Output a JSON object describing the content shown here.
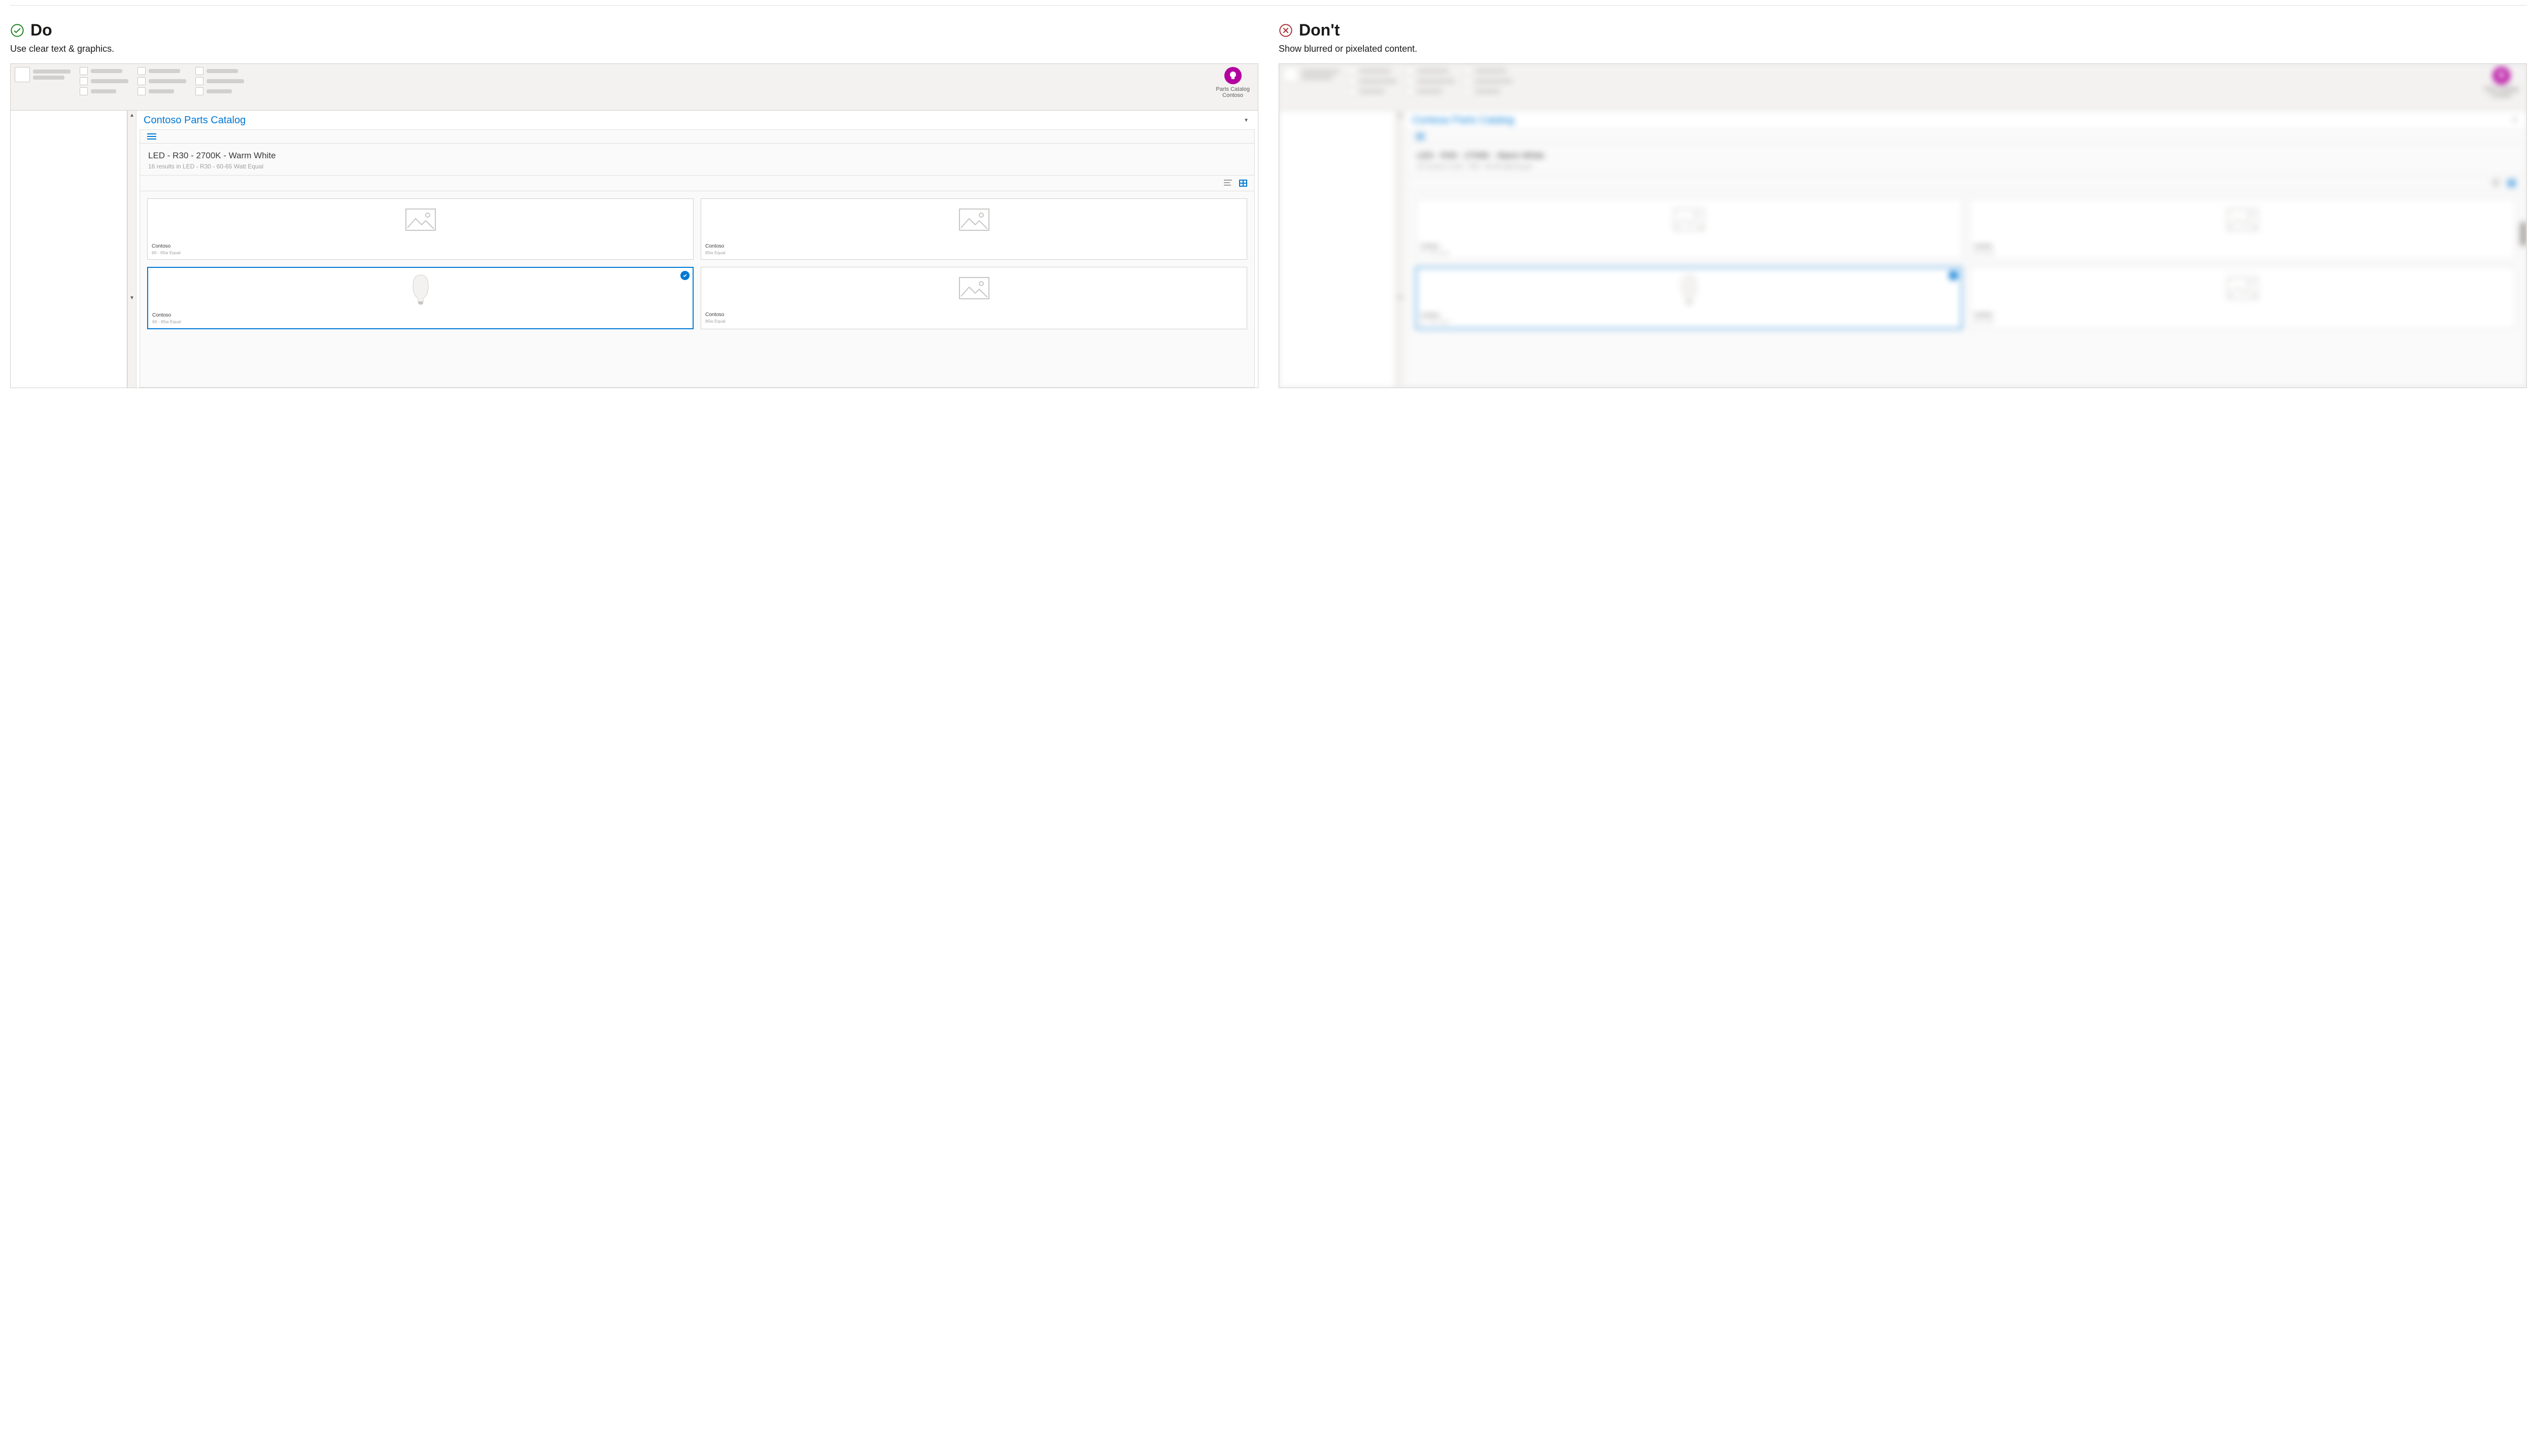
{
  "do": {
    "heading": "Do",
    "subtitle": "Use clear text & graphics."
  },
  "dont": {
    "heading": "Don't",
    "subtitle": "Show blurred or pixelated content."
  },
  "addin": {
    "line1": "Parts Catalog",
    "line2": "Contoso"
  },
  "pane": {
    "title": "Contoso Parts Catalog",
    "filter_title": "LED - R30 - 2700K - Warm White",
    "filter_sub": "16 results in LED - R30 - 60-65 Watt Equal"
  },
  "cards": [
    {
      "brand": "Contoso",
      "spec": "60 - 65w Equal",
      "kind": "placeholder",
      "selected": false
    },
    {
      "brand": "Contoso",
      "spec": "85w Equal",
      "kind": "placeholder",
      "selected": false
    },
    {
      "brand": "Contoso",
      "spec": "60 - 65w Equal",
      "kind": "bulb",
      "selected": true
    },
    {
      "brand": "Contoso",
      "spec": "85w Equal",
      "kind": "placeholder",
      "selected": false
    }
  ]
}
